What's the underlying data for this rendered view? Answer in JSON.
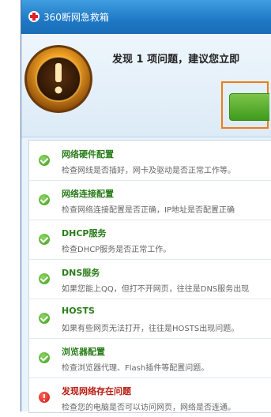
{
  "window": {
    "title": "360断网急救箱"
  },
  "header": {
    "message": "发现 1 项问题，建议您立即",
    "fix_button_label": ""
  },
  "checks": [
    {
      "title": "网络硬件配置",
      "desc": "检查网线是否插好，网卡及驱动是否正常工作等。",
      "status": "ok"
    },
    {
      "title": "网络连接配置",
      "desc": "检查网络连接配置是否正确，IP地址是否配置正确",
      "status": "ok"
    },
    {
      "title": "DHCP服务",
      "desc": "检查DHCP服务是否正常工作。",
      "status": "ok"
    },
    {
      "title": "DNS服务",
      "desc": "如果您能上QQ，但打不开网页，往往是DNS服务出现",
      "status": "ok"
    },
    {
      "title": "HOSTS",
      "desc": "如果有些网页无法打开，往往是HOSTS出现问题。",
      "status": "ok"
    },
    {
      "title": "浏览器配置",
      "desc": "检查浏览器代理、Flash插件等配置问题。",
      "status": "ok"
    },
    {
      "title": "发现网络存在问题",
      "desc": "检查您的电脑是否可以访问网页，网络是否连通。",
      "status": "error"
    }
  ],
  "colors": {
    "ok": "#3e9c1e",
    "error": "#c8140c",
    "title_bar": "#1f78c4",
    "highlight": "#f07b1c"
  }
}
